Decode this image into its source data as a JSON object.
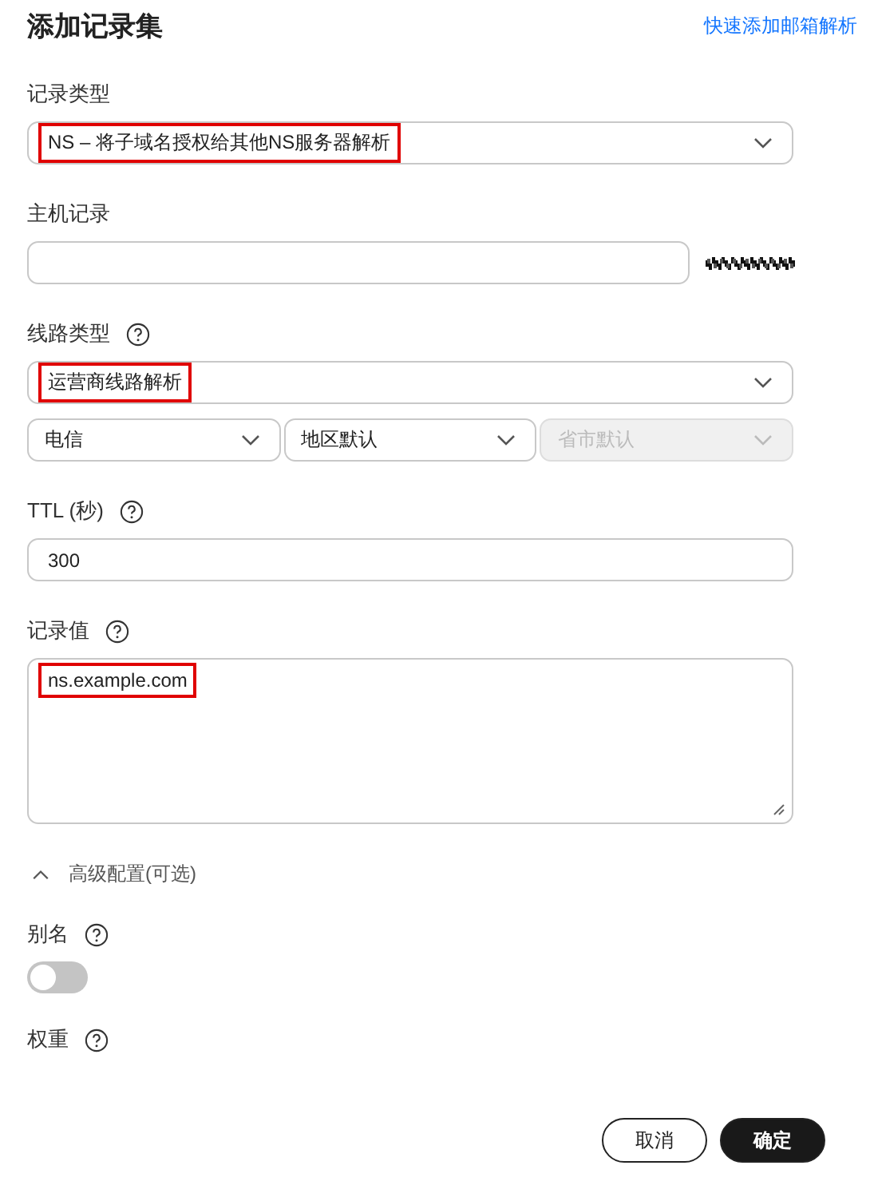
{
  "title": "添加记录集",
  "quick_link": "快速添加邮箱解析",
  "fields": [
    {
      "kind": "select",
      "label": "记录类型",
      "help": false,
      "value": "NS – 将子域名授权给其他NS服务器解析",
      "highlighted": true
    },
    {
      "kind": "input",
      "label": "主机记录",
      "help": false,
      "obscured_suffix": true
    },
    {
      "kind": "select",
      "label": "线路类型",
      "help": true,
      "value": "运营商线路解析",
      "highlighted": true,
      "sub_selects": [
        {
          "value": "电信",
          "disabled": false
        },
        {
          "value": "地区默认",
          "disabled": false
        },
        {
          "value": "省市默认",
          "disabled": true
        }
      ]
    },
    {
      "kind": "input",
      "label": "TTL (秒)",
      "help": true,
      "value": "300",
      "highlighted": false
    },
    {
      "kind": "textarea",
      "label": "记录值",
      "help": true,
      "value": "ns.example.com",
      "highlighted": true
    }
  ],
  "advanced": {
    "label": "高级配置(可选)",
    "expanded": true
  },
  "advanced_fields": [
    {
      "kind": "switch",
      "label": "别名",
      "help": true,
      "on": false
    },
    {
      "kind": "label",
      "label": "权重",
      "help": true
    }
  ],
  "buttons": [
    {
      "label": "取消",
      "primary": false
    },
    {
      "label": "确定",
      "primary": true
    }
  ]
}
